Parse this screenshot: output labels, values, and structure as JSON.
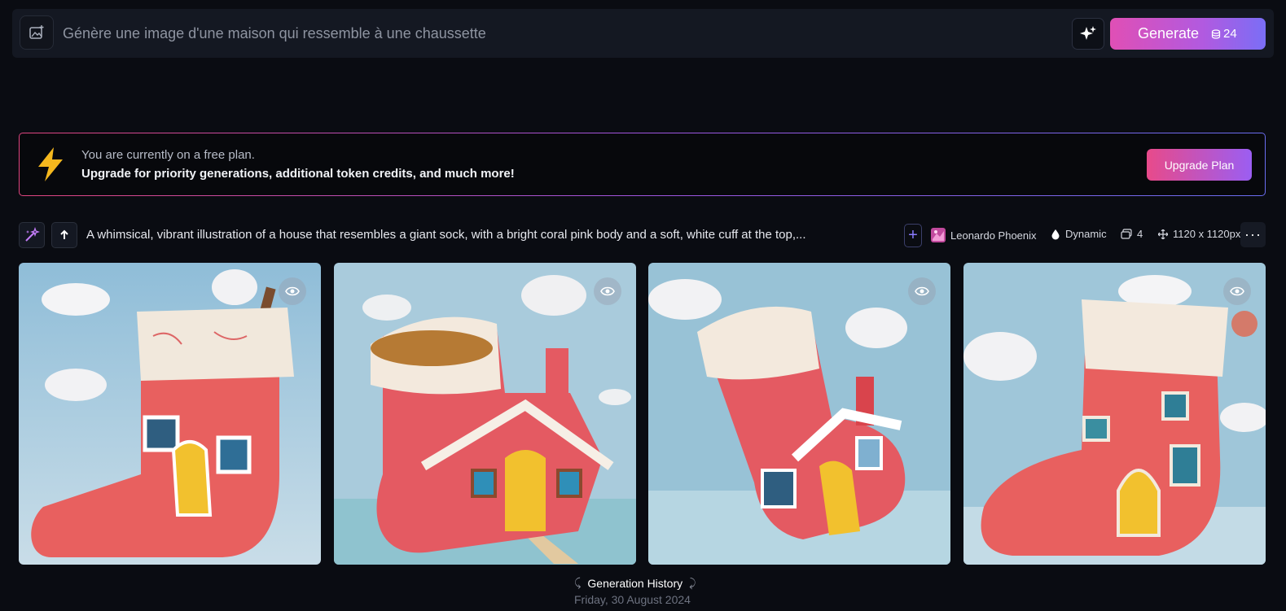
{
  "prompt_bar": {
    "placeholder": "Génère une image d'une maison qui ressemble à une chaussette",
    "generate_label": "Generate",
    "token_cost": "24",
    "icons": [
      "image-add-icon",
      "sparkle-icon",
      "coins-icon"
    ]
  },
  "banner": {
    "line1": "You are currently on a free plan.",
    "line2": "Upgrade for priority generations, additional token credits, and much more!",
    "upgrade_label": "Upgrade Plan",
    "icon": "lightning-bolt-icon"
  },
  "generation": {
    "prompt": "A whimsical, vibrant illustration of a house that resembles a giant sock, with a bright coral pink body and a soft, white cuff at the top,...",
    "model": "Leonardo Phoenix",
    "style": "Dynamic",
    "count": "4",
    "size": "1120 x 1120px",
    "plus_label": "+",
    "more_label": "···",
    "images": [
      {
        "alt": "sock house 1"
      },
      {
        "alt": "sock house 2"
      },
      {
        "alt": "sock house 3"
      },
      {
        "alt": "sock house 4"
      }
    ]
  },
  "footer": {
    "history_label": "Generation History",
    "date": "Friday, 30 August 2024"
  },
  "colors": {
    "background": "#0a0c12",
    "accent_pink": "#e04fb5",
    "accent_blue": "#7a6ef6",
    "sock_coral": "#e8605f"
  }
}
